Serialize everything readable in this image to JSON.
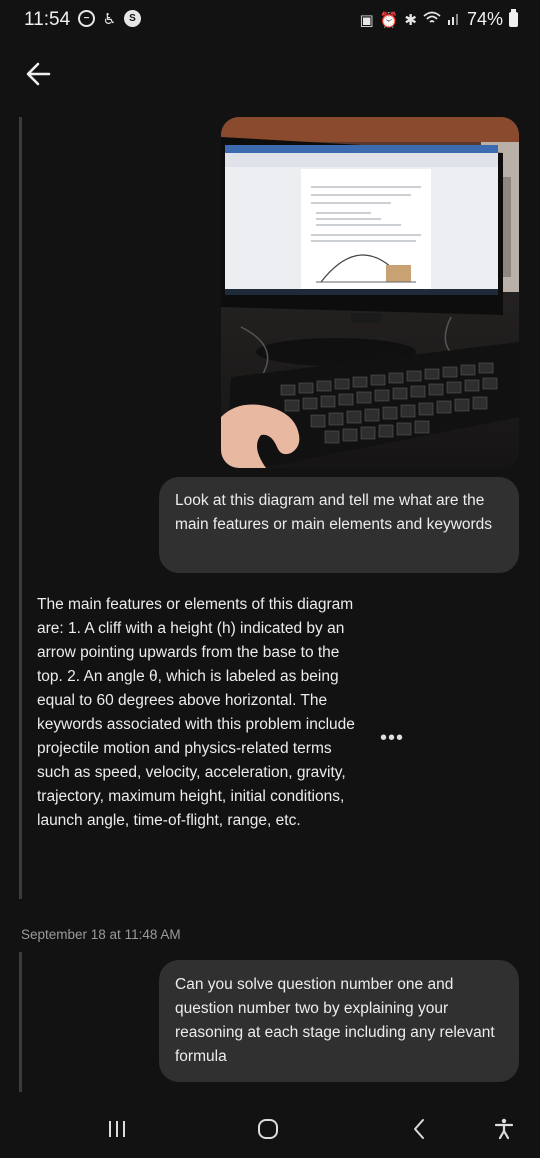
{
  "status_bar": {
    "time": "11:54",
    "battery": "74%",
    "left_icons": [
      "do-not-disturb-icon",
      "accessibility-icon",
      "s-app-icon"
    ],
    "right_icons": [
      "screenshot-icon",
      "alarm-icon",
      "bluetooth-icon",
      "wifi-icon",
      "signal-icon",
      "battery-icon"
    ]
  },
  "header": {
    "back_icon": "arrow-left-icon"
  },
  "messages": {
    "user_1": "Look at this diagram and tell me what are the main features or main elements and keywords",
    "assistant_1": "The main features or elements of this diagram are: 1. A cliff with a height (h) indicated by an arrow pointing upwards from the base to the top. 2. An angle θ, which is labeled as being equal to 60 degrees above horizontal. The keywords associated with this problem include projectile motion and physics-related terms such as speed, velocity, acceleration, gravity, trajectory, maximum height, initial conditions, launch angle, time-of-flight, range, etc.",
    "more_label": "•••",
    "timestamp": "September 18 at 11:48 AM",
    "user_2": "Can you solve question number one and question number two by explaining your reasoning at each stage including any relevant formula"
  },
  "nav_bar": {
    "icons": [
      "recent-apps-icon",
      "home-icon",
      "back-nav-icon",
      "accessibility-icon"
    ]
  },
  "colors": {
    "background": "#121212",
    "bubble": "#303030",
    "text": "#ececec",
    "muted": "#9a9a9a",
    "thread_line": "#3b3b3b"
  }
}
